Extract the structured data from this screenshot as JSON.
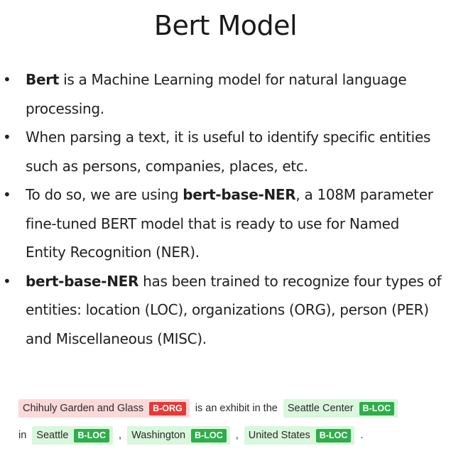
{
  "title": "Bert Model",
  "bullets": [
    {
      "bold_lead": "Bert",
      "text": " is a Machine Learning model for natural language processing."
    },
    {
      "text": "When parsing a text, it is useful to identify specific entities such as persons, companies, places, etc."
    },
    {
      "pre": "To do so, we are using ",
      "bold": "bert-base-NER",
      "post": ", a 108M parameter fine-tuned BERT model that is ready to use for Named Entity Recognition (NER)."
    },
    {
      "bold_lead": "bert-base-NER",
      "text": " has been trained to recognize four types of entities: location (LOC), organizations (ORG), person (PER) and Miscellaneous (MISC)."
    }
  ],
  "ner_example": {
    "entity_1": "Chihuly Garden and Glass",
    "tag_1": "B-ORG",
    "text_1": "is an exhibit in the",
    "entity_2": "Seattle Center",
    "tag_2": "B-LOC",
    "text_2": "in",
    "entity_3": "Seattle",
    "tag_3": "B-LOC",
    "sep_1": ",",
    "entity_4": "Washington",
    "tag_4": "B-LOC",
    "sep_2": ",",
    "entity_5": "United States",
    "tag_5": "B-LOC",
    "end": "."
  },
  "colors": {
    "org_highlight": "#fcd9d9",
    "org_tag": "#e53935",
    "loc_highlight": "#d9f7dc",
    "loc_tag": "#2eae4a"
  }
}
